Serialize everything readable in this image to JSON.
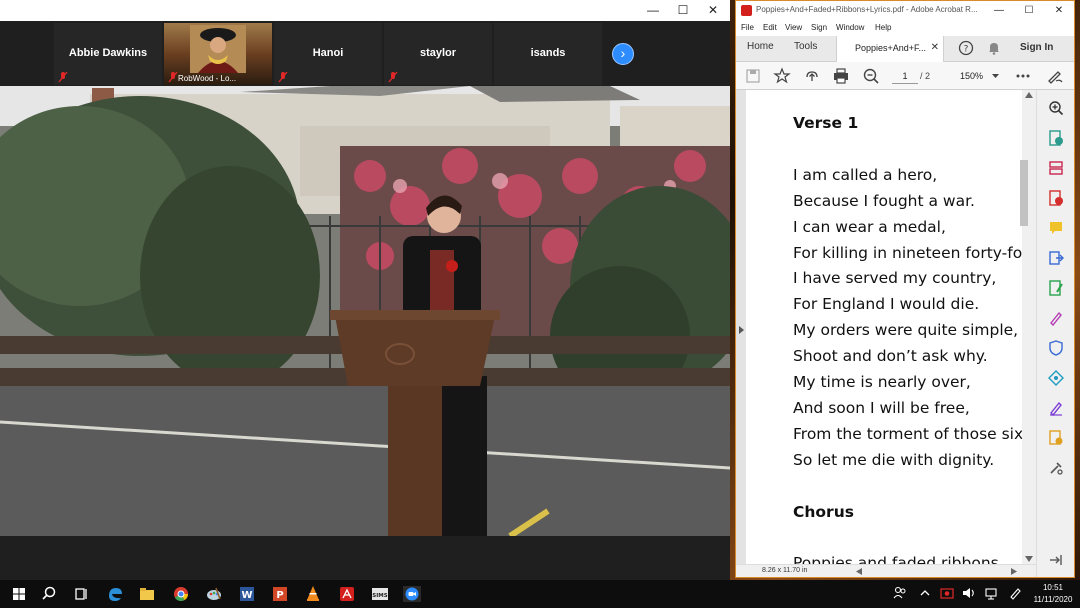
{
  "zoom": {
    "window_controls": [
      "—",
      "☐",
      "✕"
    ],
    "participants": [
      {
        "name": "Abbie Dawkins"
      },
      {
        "name": "RobWood - Lo..."
      },
      {
        "name": "Hanoi"
      },
      {
        "name": "staylor"
      },
      {
        "name": "isands"
      }
    ],
    "next_symbol": "›"
  },
  "acrobat": {
    "title": "Poppies+And+Faded+Ribbons+Lyrics.pdf - Adobe Acrobat R...",
    "window_controls": [
      "—",
      "☐",
      "✕"
    ],
    "menu": [
      "File",
      "Edit",
      "View",
      "Sign",
      "Window",
      "Help"
    ],
    "tabs": {
      "home": "Home",
      "tools": "Tools",
      "doc": "Poppies+And+F...",
      "close": "✕"
    },
    "sign_in": "Sign In",
    "page_current": "1",
    "page_total": "/ 2",
    "zoom_level": "150%",
    "document_lines": [
      {
        "text": "Verse 1",
        "heading": true
      },
      {
        "text": "I am called a hero,",
        "heading": false
      },
      {
        "text": "Because I fought a war.",
        "heading": false
      },
      {
        "text": "I can wear a medal,",
        "heading": false
      },
      {
        "text": "For killing in nineteen forty-fou",
        "heading": false
      },
      {
        "text": "I have served my country,",
        "heading": false
      },
      {
        "text": "For England I would die.",
        "heading": false
      },
      {
        "text": "My orders were quite simple,",
        "heading": false
      },
      {
        "text": "Shoot and don’t ask why.",
        "heading": false
      },
      {
        "text": "My time is nearly over,",
        "heading": false
      },
      {
        "text": "And soon I will be free,",
        "heading": false
      },
      {
        "text": "From the torment of those six lo",
        "heading": false
      },
      {
        "text": "So let me die with dignity.",
        "heading": false
      },
      {
        "text": "Chorus",
        "heading": true
      },
      {
        "text": "Poppies and faded ribbons",
        "heading": false
      }
    ],
    "page_size": "8.26 x 11.70 in"
  },
  "taskbar": {
    "time": "10:51",
    "date": "11/11/2020"
  }
}
